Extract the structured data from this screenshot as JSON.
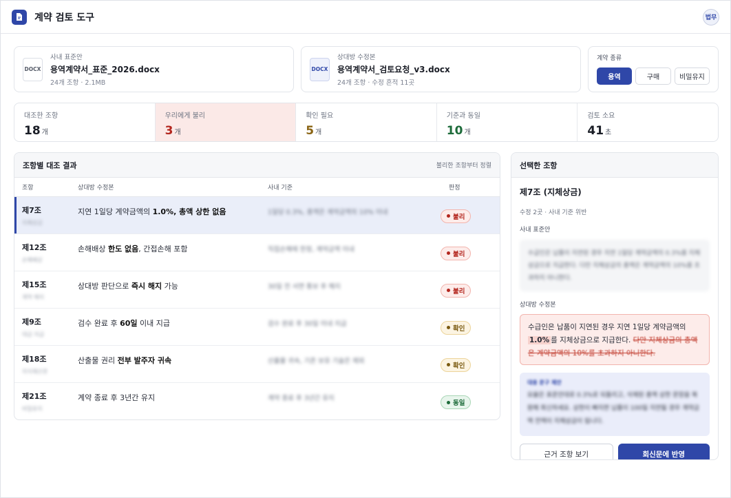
{
  "app": {
    "title": "계약 검토 도구",
    "user_badge": "법무",
    "accent": "#2f47a8"
  },
  "files": {
    "internal": {
      "role": "사내 표준안",
      "badge": "DOCX",
      "name": "용역계약서_표준_2026.docx",
      "meta": "24개 조항 · 2.1MB"
    },
    "counterparty": {
      "role": "상대방 수정본",
      "badge": "DOCX",
      "name": "용역계약서_검토요청_v3.docx",
      "meta": "24개 조항 · 수정 흔적 11곳"
    }
  },
  "contract_type": {
    "label": "계약 종류",
    "options": [
      "용역",
      "구매",
      "비밀유지"
    ],
    "selected": "용역"
  },
  "stats": [
    {
      "label": "대조한 조항",
      "value": "18",
      "unit": "개",
      "color": "#1a1d26"
    },
    {
      "label": "우리에게 불리",
      "value": "3",
      "unit": "개",
      "color": "#b3261e"
    },
    {
      "label": "확인 필요",
      "value": "5",
      "unit": "개",
      "color": "#8a6414"
    },
    {
      "label": "기준과 동일",
      "value": "10",
      "unit": "개",
      "color": "#1d6b3a"
    },
    {
      "label": "검토 소요",
      "value": "41",
      "unit": "초",
      "color": "#1a1d26"
    }
  ],
  "comparison": {
    "title": "조항별 대조 결과",
    "sort_label": "불리한 조항부터 정렬",
    "columns": [
      "조항",
      "상대방 수정본",
      "사내 기준",
      "판정"
    ],
    "rows": [
      {
        "clause": "제7조",
        "topic": "지체상금",
        "cp_pre": "지연 1일당 계약금액의 ",
        "cp_bold": "1.0%, 총액 상한 없음",
        "cp_post": "",
        "standard": "1일당 0.3%, 총액은 계약금액의 10% 이내",
        "verdict": "불리",
        "vclass": "v-bad",
        "selected": true
      },
      {
        "clause": "제12조",
        "topic": "손해배상",
        "cp_pre": "손해배상 ",
        "cp_bold": "한도 없음",
        "cp_post": ", 간접손해 포함",
        "standard": "직접손해에 한정, 계약금액 이내",
        "verdict": "불리",
        "vclass": "v-bad",
        "selected": false
      },
      {
        "clause": "제15조",
        "topic": "계약 해지",
        "cp_pre": "상대방 판단으로 ",
        "cp_bold": "즉시 해지",
        "cp_post": " 가능",
        "standard": "30일 전 서면 통보 후 해지",
        "verdict": "불리",
        "vclass": "v-bad",
        "selected": false
      },
      {
        "clause": "제9조",
        "topic": "대금 지급",
        "cp_pre": "검수 완료 후 ",
        "cp_bold": "60일",
        "cp_post": " 이내 지급",
        "standard": "검수 완료 후 30일 이내 지급",
        "verdict": "확인",
        "vclass": "v-check",
        "selected": false
      },
      {
        "clause": "제18조",
        "topic": "지식재산권",
        "cp_pre": "산출물 권리 ",
        "cp_bold": "전부 발주자 귀속",
        "cp_post": "",
        "standard": "산출물 귀속, 기존 보유 기술은 제외",
        "verdict": "확인",
        "vclass": "v-check",
        "selected": false
      },
      {
        "clause": "제21조",
        "topic": "비밀유지",
        "cp_pre": "계약 종료 후 3년간 유지",
        "cp_bold": "",
        "cp_post": "",
        "standard": "계약 종료 후 3년간 유지",
        "verdict": "동일",
        "vclass": "v-same",
        "selected": false
      }
    ]
  },
  "detail": {
    "panel_title": "선택한 조항",
    "clause_title": "제7조 (지체상금)",
    "summary": "수정 2곳 · 사내 기준 위반",
    "standard_label": "사내 표준안",
    "standard_text": "수급인은 납품이 지연된 경우 지연 1일당 계약금액의 0.3%를 지체상금으로 지급한다. 다만 지체상금의 총액은 계약금액의 10%를 초과하지 아니한다.",
    "cp_label": "상대방 수정본",
    "cp_pre": "수급인은 납품이 지연된 경우 지연 1일당 계약금액의 ",
    "cp_hl": "1.0%",
    "cp_mid": "를 지체상금으로 지급한다. ",
    "cp_del": "다만 지체상금의 총액은 계약금액의 10%를 초과하지 아니한다.",
    "suggest_label": "대응 문구 제안",
    "suggest_text": "요율은 표준안대로 0.3%로 되돌리고, 삭제된 총액 상한 문장을 복원해 회신하세요. 상한이 빠지면 납품이 100일 지연될 경우 계약금액 전액이 지체상금이 됩니다.",
    "btn_secondary": "근거 조항 보기",
    "btn_primary": "회신문에 반영"
  }
}
